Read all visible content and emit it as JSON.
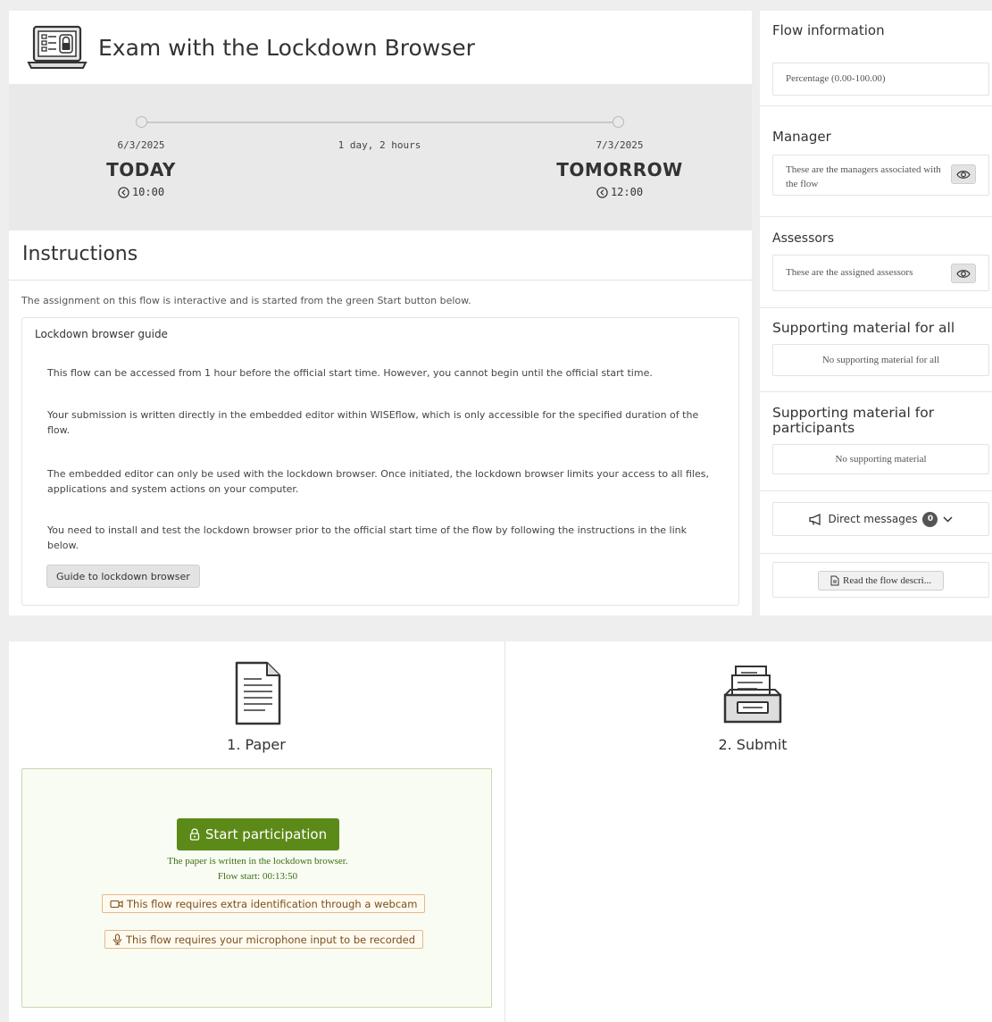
{
  "header": {
    "title": "Exam with the Lockdown Browser",
    "icon": "laptop-lock-icon"
  },
  "timeline": {
    "start": {
      "date": "6/3/2025",
      "day": "TODAY",
      "time": "10:00"
    },
    "duration": "1 day, 2 hours",
    "end": {
      "date": "7/3/2025",
      "day": "TOMORROW",
      "time": "12:00"
    }
  },
  "instructions": {
    "heading": "Instructions",
    "intro": "The assignment on this flow is interactive and is started from the green Start button below.",
    "guide": {
      "title": "Lockdown browser guide",
      "paragraphs": [
        "This flow can be accessed from 1 hour before the official start time. However, you cannot begin until the official start time.",
        "Your submission is written directly in the embedded editor within WISEflow, which is only accessible for the specified duration of the flow.",
        "The embedded editor can only be used with the lockdown browser. Once initiated, the lockdown browser limits your access to all files, applications and system actions on your computer.",
        "You need to install and test the lockdown browser prior to the official start time of the flow by following the instructions in the link below."
      ],
      "button_label": "Guide to lockdown browser"
    }
  },
  "sidebar": {
    "flow_info": {
      "title": "Flow information",
      "value": "Percentage (0.00-100.00)"
    },
    "manager": {
      "title": "Manager",
      "text": "These are the managers associated with the flow"
    },
    "assessors": {
      "title": "Assessors",
      "text": "These are the assigned assessors"
    },
    "support_all": {
      "title": "Supporting material for all",
      "text": "No supporting material for all"
    },
    "support_participants": {
      "title": "Supporting material for participants",
      "text": "No supporting material"
    },
    "direct_messages": {
      "label": "Direct messages",
      "count": "0"
    },
    "read_button": "Read the flow descri..."
  },
  "steps": [
    {
      "label": "1. Paper",
      "icon": "paper-document-icon"
    },
    {
      "label": "2. Submit",
      "icon": "submit-tray-icon"
    }
  ],
  "participation": {
    "button_label": "Start participation",
    "note": "The paper is written in the lockdown browser.",
    "flow_start": "Flow start: 00:13:50",
    "webcam_req": "This flow requires extra identification through a webcam",
    "mic_req": "This flow requires your microphone input to be recorded"
  },
  "colors": {
    "start_button": "#5c8a18",
    "green_box_bg": "#f8fcf3",
    "requirement_border": "#e6b98a"
  }
}
